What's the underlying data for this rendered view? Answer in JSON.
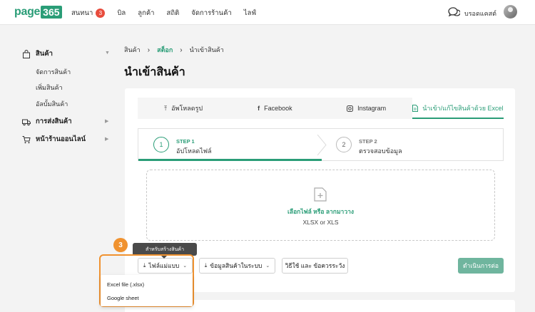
{
  "app": {
    "logo_text": "page",
    "logo_num": "365",
    "nav": [
      {
        "label": "สนทนา",
        "badge": "3"
      },
      {
        "label": "บิล"
      },
      {
        "label": "ลูกค้า"
      },
      {
        "label": "สถิติ"
      },
      {
        "label": "จัดการร้านค้า"
      },
      {
        "label": "ไลฟ์"
      }
    ],
    "user_name": "บรอดแคสต์"
  },
  "sidebar": {
    "product": {
      "label": "สินค้า",
      "icon": "bag-icon"
    },
    "product_subs": [
      "จัดการสินค้า",
      "เพิ่มสินค้า",
      "อัลบั้มสินค้า"
    ],
    "shipping": {
      "label": "การส่งสินค้า",
      "icon": "truck-icon"
    },
    "storefront": {
      "label": "หน้าร้านออนไลน์",
      "icon": "cart-icon"
    }
  },
  "breadcrumb": [
    "สินค้า",
    "สต็อก",
    "นำเข้าสินค้า"
  ],
  "page_title": "นำเข้าสินค้า",
  "tabs": [
    {
      "label": "อัพโหลดรูป",
      "icon": "upload-icon"
    },
    {
      "label": "Facebook",
      "icon": "facebook-icon"
    },
    {
      "label": "Instagram",
      "icon": "instagram-icon"
    },
    {
      "label": "นำเข้า/แก้ไขสินค้าด้วย Excel",
      "icon": "file-icon",
      "active": true
    }
  ],
  "steps": [
    {
      "num": "1",
      "label": "STEP 1",
      "desc": "อัปโหลดไฟล์",
      "active": true
    },
    {
      "num": "2",
      "label": "STEP 2",
      "desc": "ตรวจสอบข้อมูล",
      "active": false
    }
  ],
  "dropzone": {
    "link_text": "เลือกไฟล์ หรือ ลากมาวาง",
    "sub_text": "XLSX or XLS"
  },
  "buttons": {
    "template": "ไฟล์แม่แบบ",
    "system_data": "ข้อมูลสินค้าในระบบ",
    "howto": "วิธีใช้ และ ข้อควรระวัง",
    "continue": "ดำเนินการต่อ"
  },
  "tooltip": "สำหรับสร้างสินค้า",
  "callout_number": "3",
  "dropdown_options": [
    "Excel file (.xlsx)",
    "Google sheet"
  ],
  "colors": {
    "accent": "#2a9d77",
    "callout": "#f0922f",
    "badge": "#e84c3d"
  }
}
